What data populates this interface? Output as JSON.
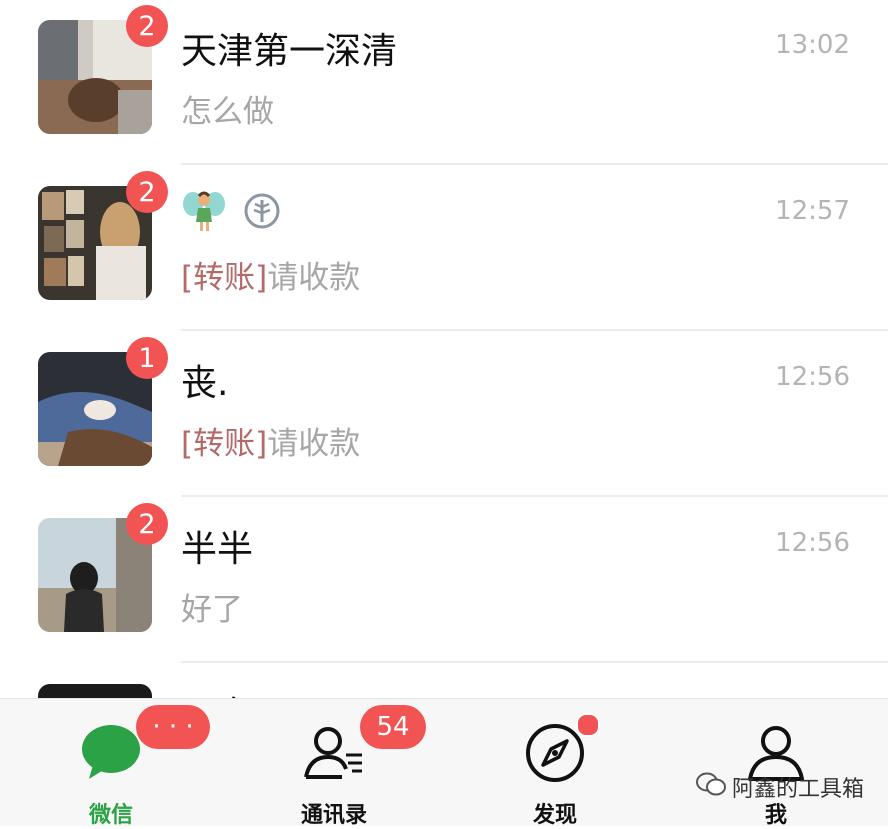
{
  "chats": [
    {
      "name": "天津第一深清",
      "preview": "怎么做",
      "time": "13:02",
      "badge": "2"
    },
    {
      "name": "",
      "preview_tag": "[转账]",
      "preview": "请收款",
      "time": "12:57",
      "badge": "2",
      "name_icons": [
        "fairy-emoji-icon",
        "leaf-circle-icon"
      ]
    },
    {
      "name": "丧.",
      "preview_tag": "[转账]",
      "preview": "请收款",
      "time": "12:56",
      "badge": "1"
    },
    {
      "name": "半半",
      "preview": "好了",
      "time": "12:56",
      "badge": "2"
    },
    {
      "name": "阿乌",
      "preview": "",
      "time": "",
      "badge": ""
    }
  ],
  "tabbar": {
    "tabs": [
      {
        "label": "微信",
        "icon": "chat-bubble-icon",
        "badge": "· · ·",
        "active": true
      },
      {
        "label": "通讯录",
        "icon": "contacts-icon",
        "badge": "54"
      },
      {
        "label": "发现",
        "icon": "compass-icon",
        "dot": true
      },
      {
        "label": "我",
        "icon": "person-icon"
      }
    ]
  },
  "watermark": {
    "text": "阿鑫的工具箱",
    "icon": "wechat-official-account-icon"
  },
  "colors": {
    "accent_green": "#2ba245",
    "badge_red": "#f25353",
    "transfer_tag": "#b26a6a"
  }
}
